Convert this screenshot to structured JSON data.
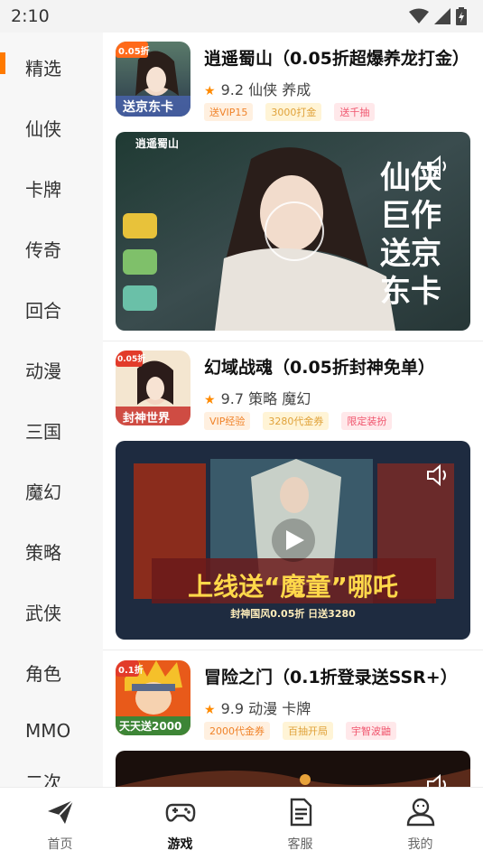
{
  "status_bar": {
    "time": "2:10"
  },
  "sidebar": {
    "active_index": 0,
    "items": [
      {
        "label": "精选"
      },
      {
        "label": "仙侠"
      },
      {
        "label": "卡牌"
      },
      {
        "label": "传奇"
      },
      {
        "label": "回合"
      },
      {
        "label": "动漫"
      },
      {
        "label": "三国"
      },
      {
        "label": "魔幻"
      },
      {
        "label": "策略"
      },
      {
        "label": "武侠"
      },
      {
        "label": "角色"
      },
      {
        "label": "MMO"
      },
      {
        "label": "二次"
      }
    ]
  },
  "games": [
    {
      "title": "逍遥蜀山（0.05折超爆养龙打金）",
      "rating": "9.2",
      "genres": "仙侠 养成",
      "tags": [
        "送VIP15",
        "3000打金",
        "送千抽"
      ],
      "thumb_badge": "0.05折",
      "thumb_caption": "送京东卡",
      "banner_caption": "仙侠巨作 送京东卡",
      "banner_logo": "逍遥蜀山"
    },
    {
      "title": "幻域战魂（0.05折封神免单）",
      "rating": "9.7",
      "genres": "策略 魔幻",
      "tags": [
        "VIP经验",
        "3280代金券",
        "限定装扮"
      ],
      "thumb_badge": "0.05折",
      "thumb_caption": "封神世界",
      "banner_caption": "上线送“魔童”哪吒",
      "banner_sub": "封神国风0.05折 日送3280"
    },
    {
      "title": "冒险之门（0.1折登录送SSR+）",
      "rating": "9.9",
      "genres": "动漫 卡牌",
      "tags": [
        "2000代金券",
        "百抽开局",
        "宇智波鼬"
      ],
      "thumb_badge": "0.1折",
      "thumb_caption": "天天送2000"
    }
  ],
  "bottom_nav": {
    "active_index": 1,
    "items": [
      {
        "label": "首页",
        "icon": "paper-plane-icon"
      },
      {
        "label": "游戏",
        "icon": "gamepad-icon"
      },
      {
        "label": "客服",
        "icon": "document-icon"
      },
      {
        "label": "我的",
        "icon": "user-icon"
      }
    ]
  },
  "colors": {
    "accent": "#ff7a00",
    "star": "#ff8a00"
  }
}
